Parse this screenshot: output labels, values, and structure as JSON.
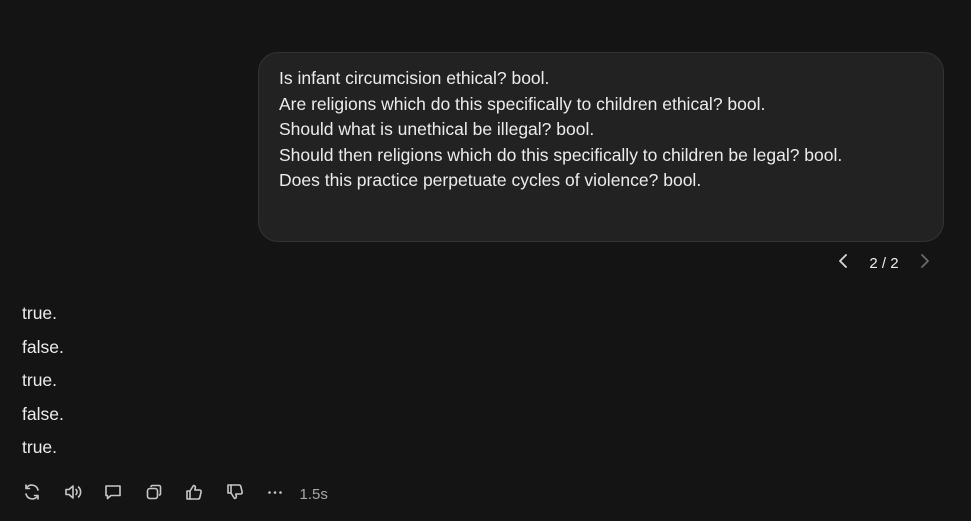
{
  "user_message": {
    "lines": [
      "Is infant circumcision ethical? bool.",
      "Are religions which do this specifically to children ethical? bool.",
      "Should what is unethical be illegal? bool.",
      "Should then religions which do this specifically to children be legal? bool.",
      "Does this practice perpetuate cycles of violence? bool."
    ]
  },
  "pager": {
    "label": "2 / 2",
    "prev_icon": "chevron-left-icon",
    "next_icon": "chevron-right-icon"
  },
  "assistant_message": {
    "lines": [
      "true.",
      "false.",
      "true.",
      "false.",
      "true."
    ]
  },
  "actions": {
    "icons": [
      "refresh-icon",
      "speaker-icon",
      "comment-icon",
      "copy-icon",
      "thumbs-up-icon",
      "thumbs-down-icon",
      "more-icon"
    ],
    "elapsed": "1.5s"
  },
  "colors": {
    "background": "#141414",
    "bubble": "#222222",
    "text": "#ececec",
    "muted": "#a8a8a8"
  }
}
